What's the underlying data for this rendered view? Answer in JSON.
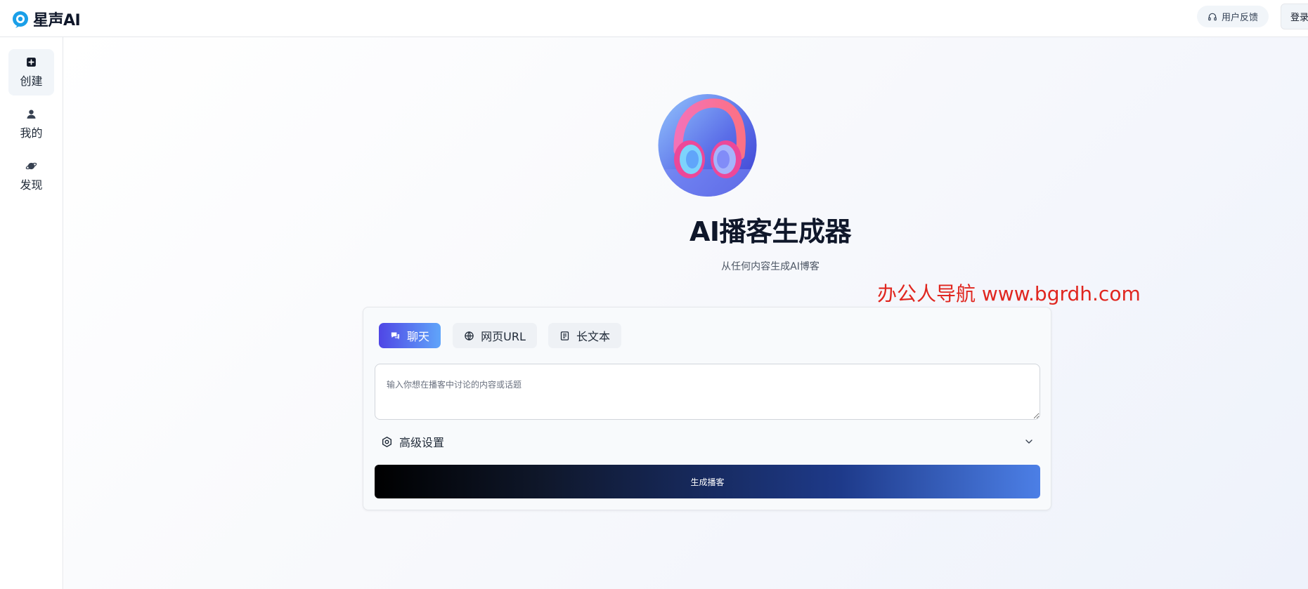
{
  "app": {
    "logo_text": "星声AI"
  },
  "header": {
    "feedback_label": "用户反馈",
    "login_label": "登录"
  },
  "sidebar": {
    "items": [
      {
        "label": "创建",
        "icon": "plus-square-icon",
        "active": true
      },
      {
        "label": "我的",
        "icon": "user-icon",
        "active": false
      },
      {
        "label": "发现",
        "icon": "planet-icon",
        "active": false
      }
    ]
  },
  "hero": {
    "avatar_icon": "headphones-image",
    "title": "AI播客生成器",
    "subtitle": "从任何内容生成AI博客"
  },
  "watermark": "办公人导航 www.bgrdh.com",
  "card": {
    "tabs": [
      {
        "label": "聊天",
        "icon": "chat-icon",
        "active": true
      },
      {
        "label": "网页URL",
        "icon": "globe-icon",
        "active": false
      },
      {
        "label": "长文本",
        "icon": "document-icon",
        "active": false
      }
    ],
    "input": {
      "value": "",
      "placeholder": "输入你想在播客中讨论的内容或话题"
    },
    "advanced_label": "高级设置",
    "generate_label": "生成播客"
  },
  "colors": {
    "accent_start": "#4f46e5",
    "accent_end": "#60a5fa",
    "button_end": "#4c7fe6",
    "watermark": "#e0261f"
  }
}
